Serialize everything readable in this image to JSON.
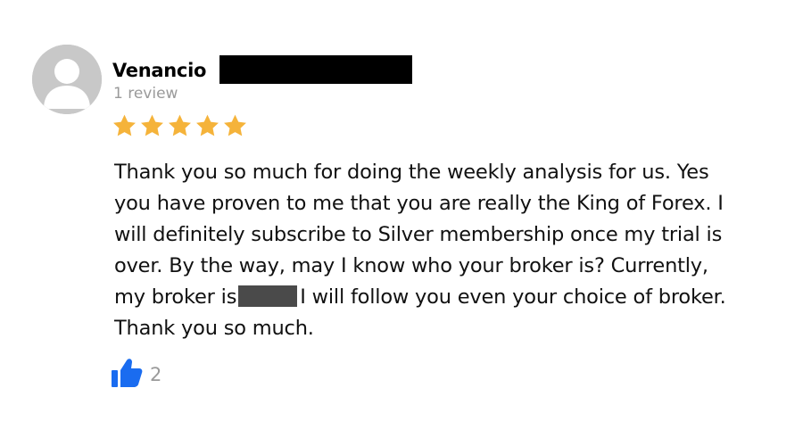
{
  "reviewer": {
    "name": "Venancio",
    "review_count": "1 review"
  },
  "rating": {
    "stars": 5,
    "max": 5,
    "color": "#f5b33a"
  },
  "review": {
    "lines": [
      "Thank you so much for doing the weekly analysis for us. Yes",
      "you have proven to me that you are really the King of Forex. I",
      "will definitely subscribe to Silver membership once my trial is",
      "over. By the way, may I know who your broker is? Currently,",
      "Thank you so much."
    ],
    "line5_before": "my broker is",
    "line5_after": "I will follow you even your choice of broker."
  },
  "likes": {
    "count": "2",
    "icon": "thumbs-up-icon",
    "color": "#1a6cf0"
  }
}
